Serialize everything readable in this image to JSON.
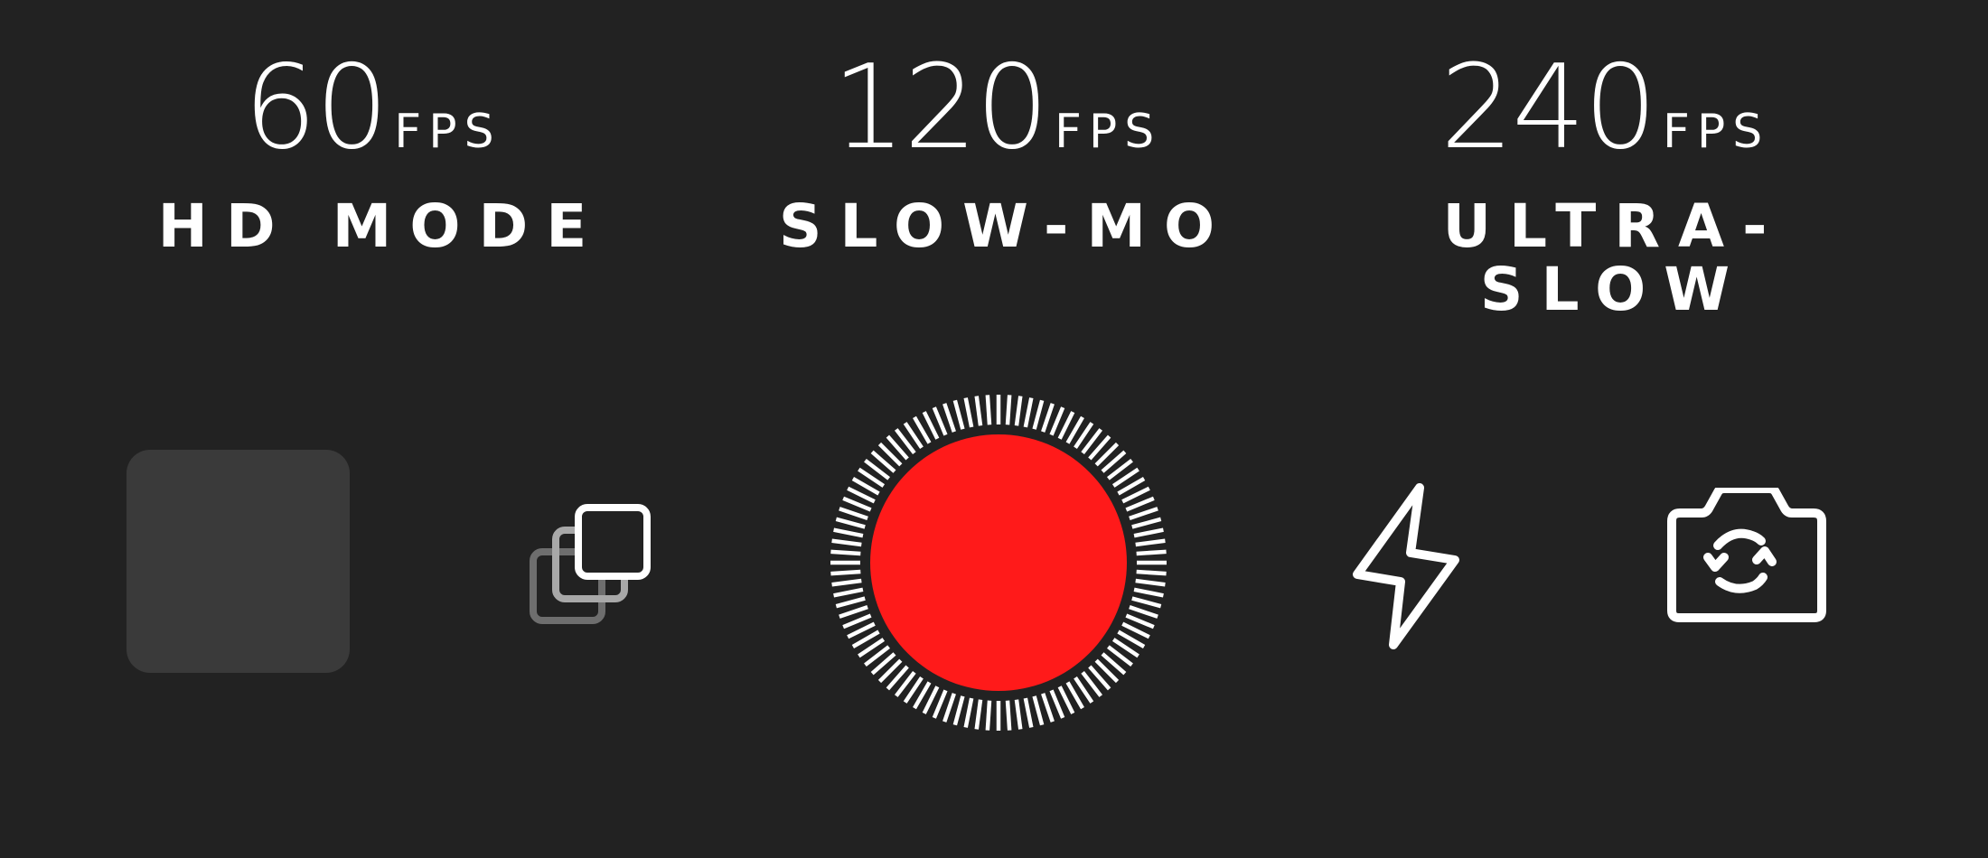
{
  "modes": [
    {
      "number": "60",
      "unit": "FPS",
      "label": "HD MODE"
    },
    {
      "number": "120",
      "unit": "FPS",
      "label": "SLOW-MO"
    },
    {
      "number": "240",
      "unit": "FPS",
      "label": "ULTRA-SLOW"
    }
  ],
  "controls": {
    "gallery": {
      "icon": "gallery-thumbnail"
    },
    "burst": {
      "icon": "burst-stack-icon"
    },
    "record": {
      "icon": "record-icon",
      "color": "#ff1a1a"
    },
    "flash": {
      "icon": "flash-icon"
    },
    "flip": {
      "icon": "flip-camera-icon"
    }
  },
  "colors": {
    "background": "#222222",
    "foreground": "#ffffff",
    "record": "#ff1a1a",
    "thumbnail": "#3a3a3a"
  }
}
